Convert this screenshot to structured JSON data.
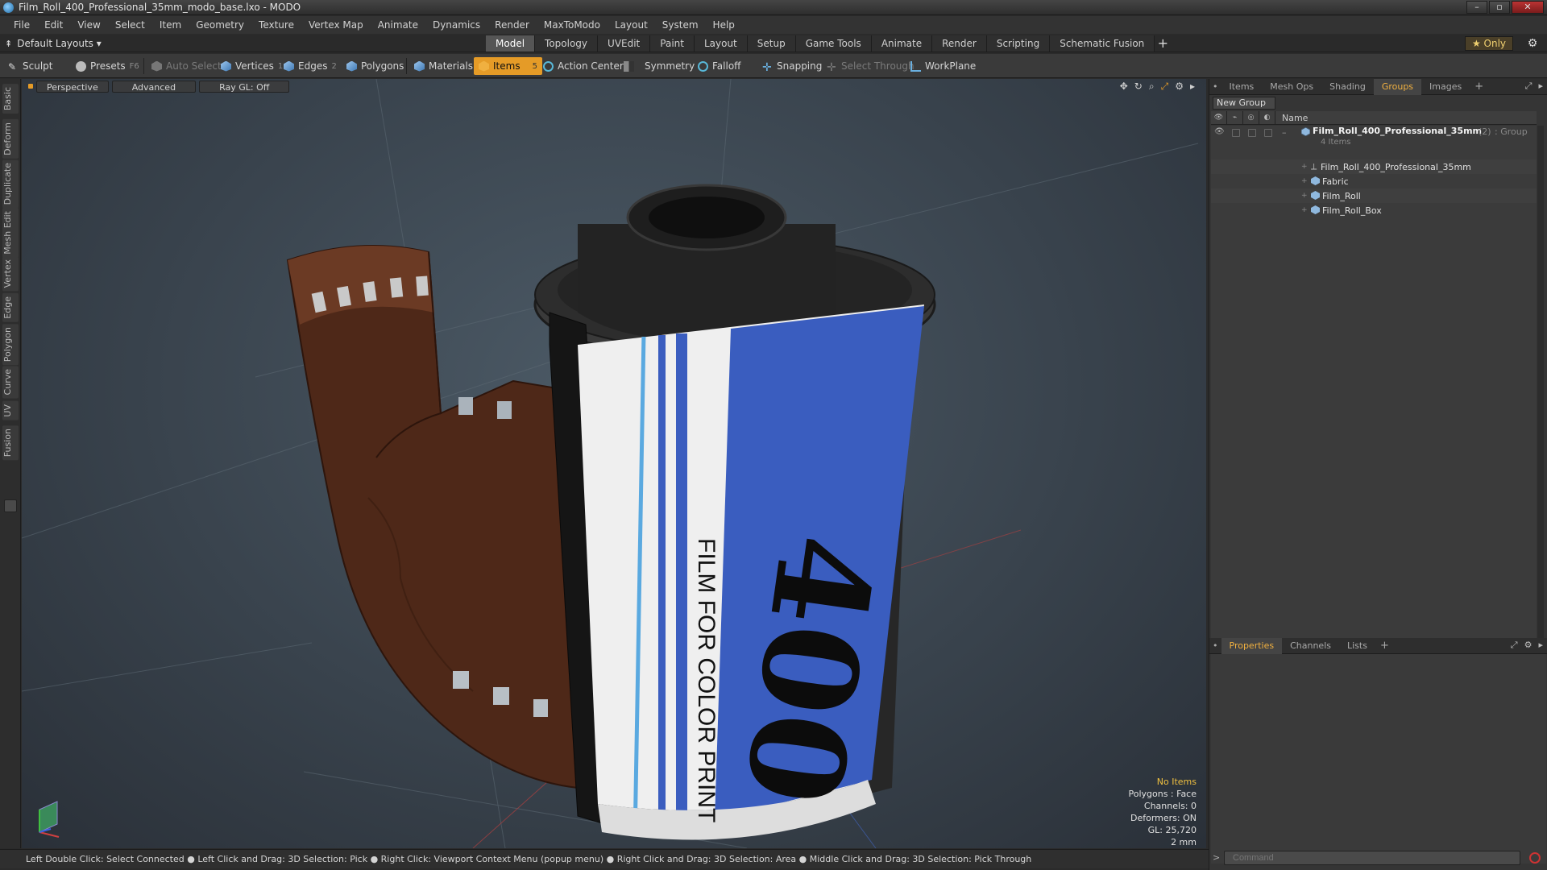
{
  "window": {
    "title": "Film_Roll_400_Professional_35mm_modo_base.lxo - MODO"
  },
  "menu": [
    "File",
    "Edit",
    "View",
    "Select",
    "Item",
    "Geometry",
    "Texture",
    "Vertex Map",
    "Animate",
    "Dynamics",
    "Render",
    "MaxToModo",
    "Layout",
    "System",
    "Help"
  ],
  "layout": {
    "selector": "Default Layouts ▾",
    "tabs": [
      "Model",
      "Topology",
      "UVEdit",
      "Paint",
      "Layout",
      "Setup",
      "Game Tools",
      "Animate",
      "Render",
      "Scripting",
      "Schematic Fusion"
    ],
    "active_tab": "Model",
    "only_label": "★  Only"
  },
  "toolbar": {
    "sculpt": "Sculpt",
    "presets": "Presets",
    "presets_key": "F6",
    "auto_select": "Auto Select",
    "vertices": "Vertices",
    "vertices_key": "1",
    "edges": "Edges",
    "edges_key": "2",
    "polygons": "Polygons",
    "materials": "Materials",
    "items": "Items",
    "items_key": "5",
    "action_center": "Action Center",
    "symmetry": "Symmetry",
    "falloff": "Falloff",
    "snapping": "Snapping",
    "select_through": "Select Through",
    "workplane": "WorkPlane"
  },
  "left_tabs": [
    "Basic",
    "Deform",
    "Duplicate",
    "Mesh Edit",
    "Vertex",
    "Edge",
    "Polygon",
    "Curve",
    "UV",
    "Fusion"
  ],
  "viewport": {
    "view": "Perspective",
    "shading": "Advanced",
    "raygl": "Ray GL: Off",
    "label_text": "FILM FOR COLOR PRINT",
    "label_number": "400",
    "info": {
      "items": "No Items",
      "polygons": "Polygons : Face",
      "channels": "Channels: 0",
      "deformers": "Deformers: ON",
      "gl": "GL: 25,720",
      "scale": "2 mm"
    }
  },
  "status": "Left Double Click: Select Connected ● Left Click and Drag: 3D Selection: Pick ● Right Click: Viewport Context Menu (popup menu) ● Right Click and Drag: 3D Selection: Area ● Middle Click and Drag: 3D Selection: Pick Through",
  "panel": {
    "tabs": [
      "Items",
      "Mesh Ops",
      "Shading",
      "Groups",
      "Images"
    ],
    "active_tab": "Groups",
    "new_group": "New Group",
    "col_name": "Name",
    "group": {
      "name": "Film_Roll_400_Professional_35mm",
      "count": "(2)",
      "type": ": Group",
      "items_label": "4 Items"
    },
    "children": [
      "Film_Roll_400_Professional_35mm",
      "Fabric",
      "Film_Roll",
      "Film_Roll_Box"
    ]
  },
  "bottom_panel": {
    "tabs": [
      "Properties",
      "Channels",
      "Lists"
    ],
    "active_tab": "Properties",
    "command_placeholder": "Command"
  },
  "colors": {
    "accent": "#e59b27",
    "label_blue": "#3a5dbf",
    "film_brown": "#5a2e1c"
  }
}
